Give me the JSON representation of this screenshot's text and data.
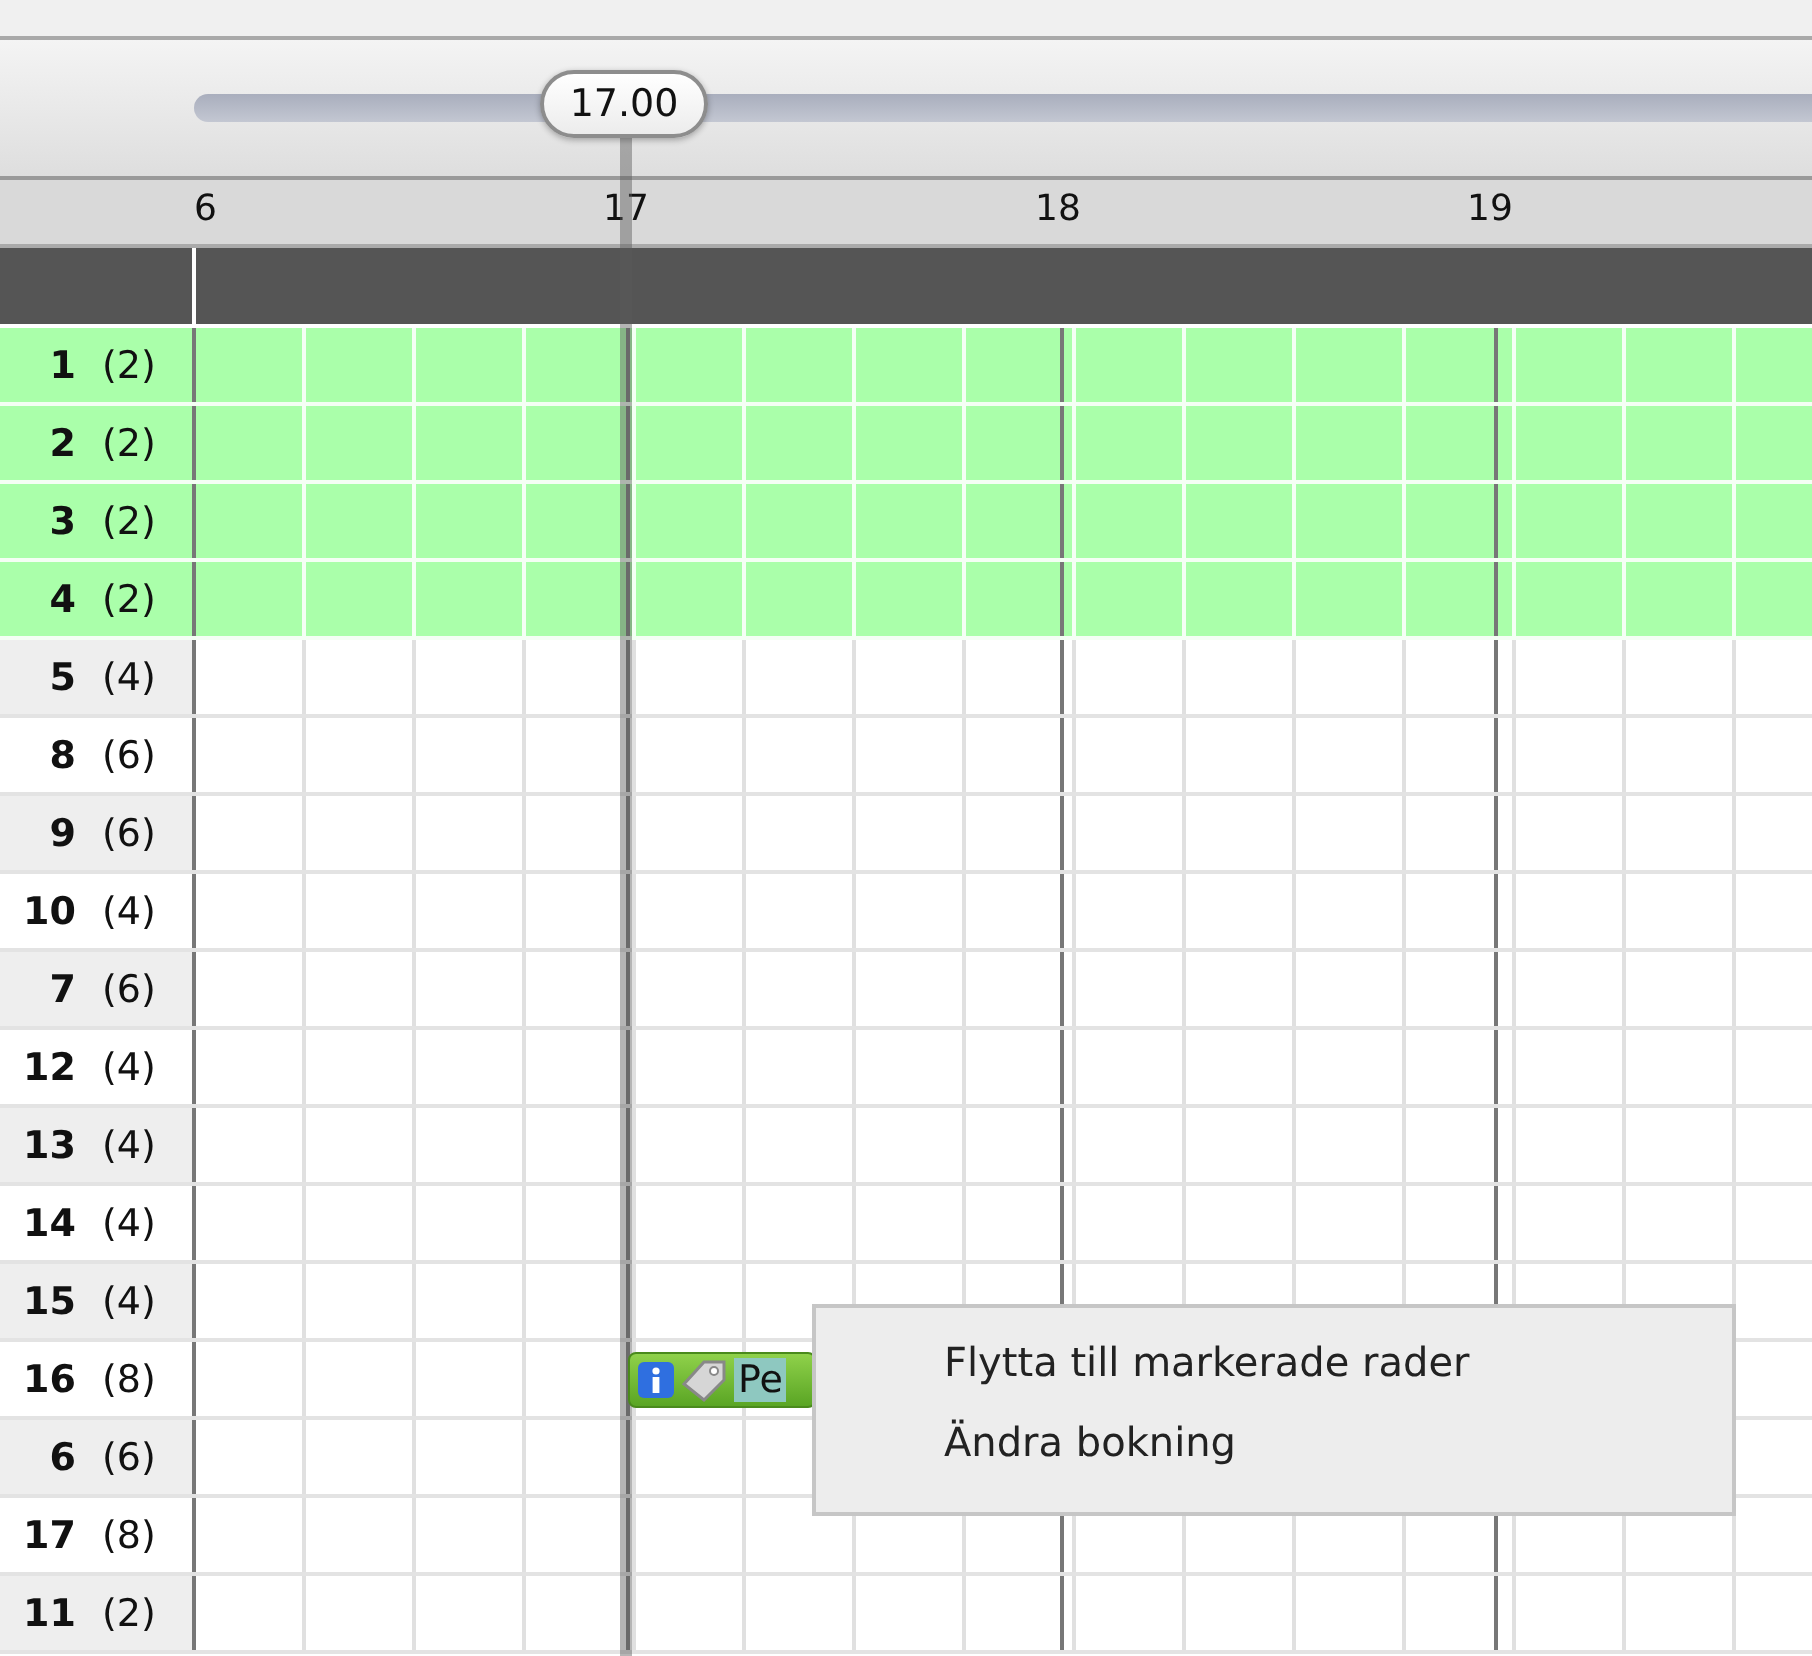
{
  "slider": {
    "value": "17.00",
    "level": 0.2625
  },
  "hours": [
    "6",
    "17",
    "18",
    "19"
  ],
  "rows": [
    {
      "number": "1",
      "capacity": "(2)",
      "selected": true
    },
    {
      "number": "2",
      "capacity": "(2)",
      "selected": true
    },
    {
      "number": "3",
      "capacity": "(2)",
      "selected": true
    },
    {
      "number": "4",
      "capacity": "(2)",
      "selected": true
    },
    {
      "number": "5",
      "capacity": "(4)",
      "selected": false
    },
    {
      "number": "8",
      "capacity": "(6)",
      "selected": false
    },
    {
      "number": "9",
      "capacity": "(6)",
      "selected": false
    },
    {
      "number": "10",
      "capacity": "(4)",
      "selected": false
    },
    {
      "number": "7",
      "capacity": "(6)",
      "selected": false
    },
    {
      "number": "12",
      "capacity": "(4)",
      "selected": false
    },
    {
      "number": "13",
      "capacity": "(4)",
      "selected": false
    },
    {
      "number": "14",
      "capacity": "(4)",
      "selected": false
    },
    {
      "number": "15",
      "capacity": "(4)",
      "selected": false
    },
    {
      "number": "16",
      "capacity": "(8)",
      "selected": false,
      "booking": {
        "label": "Pe"
      }
    },
    {
      "number": "6",
      "capacity": "(6)",
      "selected": false
    },
    {
      "number": "17",
      "capacity": "(8)",
      "selected": false
    },
    {
      "number": "11",
      "capacity": "(2)",
      "selected": false
    }
  ],
  "context_menu": {
    "items": [
      "Flytta till markerade rader",
      "Ändra bokning"
    ]
  }
}
